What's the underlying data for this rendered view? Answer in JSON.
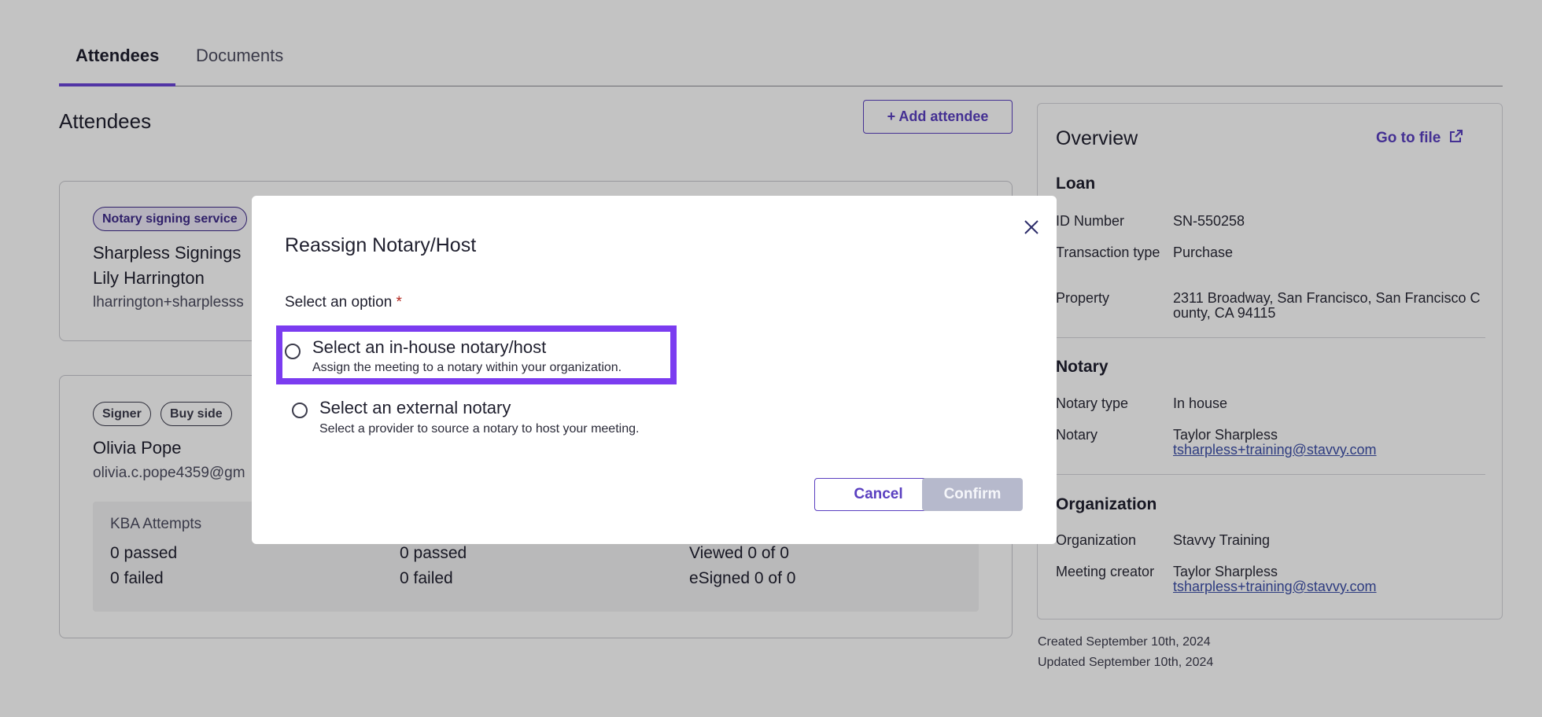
{
  "tabs": [
    {
      "label": "Attendees",
      "active": true
    },
    {
      "label": "Documents",
      "active": false
    }
  ],
  "attendees": {
    "title": "Attendees",
    "add_button": "+ Add attendee",
    "card1": {
      "pill": "Notary signing service",
      "company": "Sharpless Signings",
      "name": "Lily Harrington",
      "email": "lharrington+sharplesss"
    },
    "card2": {
      "pills": [
        "Signer",
        "Buy side"
      ],
      "name": "Olivia Pope",
      "email": "olivia.c.pope4359@gm",
      "stats": {
        "kba_label": "KBA Attempts",
        "kba_passed": "0 passed",
        "kba_failed": "0 failed",
        "col2_passed": "0 passed",
        "col2_failed": "0 failed",
        "viewed": "Viewed 0 of 0",
        "esigned": "eSigned 0 of 0"
      }
    }
  },
  "overview": {
    "title": "Overview",
    "go_to_file": "Go to file",
    "loan": {
      "heading": "Loan",
      "id_label": "ID Number",
      "id_value": "SN-550258",
      "type_label": "Transaction type",
      "type_value": "Purchase",
      "property_label": "Property",
      "property_value": "2311 Broadway, San Francisco, San Francisco County, CA 94115"
    },
    "notary": {
      "heading": "Notary",
      "type_label": "Notary type",
      "type_value": "In house",
      "notary_label": "Notary",
      "notary_name": "Taylor Sharpless",
      "notary_email": "tsharpless+training@stavvy.com"
    },
    "organization": {
      "heading": "Organization",
      "org_label": "Organization",
      "org_value": "Stavvy Training",
      "creator_label": "Meeting creator",
      "creator_name": "Taylor Sharpless",
      "creator_email": "tsharpless+training@stavvy.com"
    }
  },
  "meta": {
    "created": "Created September 10th, 2024",
    "updated": "Updated September 10th, 2024"
  },
  "modal": {
    "title": "Reassign Notary/Host",
    "field_label": "Select an option",
    "required_mark": "*",
    "options": [
      {
        "title": "Select an in-house notary/host",
        "description": "Assign the meeting to a notary within your organization.",
        "focused": true
      },
      {
        "title": "Select an external notary",
        "description": "Select a provider to source a notary to host your meeting.",
        "focused": false
      }
    ],
    "cancel_label": "Cancel",
    "confirm_label": "Confirm"
  },
  "colors": {
    "accent": "#5a3fc0",
    "focus_ring": "#7b3cf0",
    "link": "#3d4fa8",
    "disabled_button": "#b6b9cc",
    "required": "#b3261e"
  }
}
